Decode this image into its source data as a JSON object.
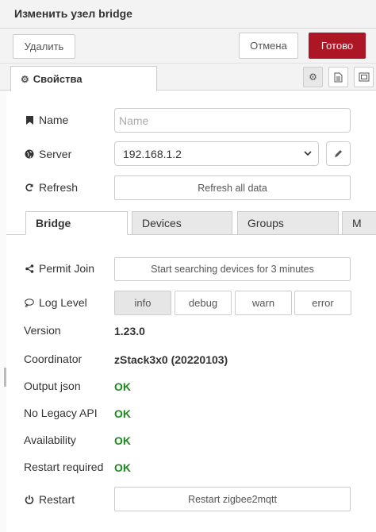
{
  "dialog": {
    "title": "Изменить узел bridge",
    "delete_label": "Удалить",
    "cancel_label": "Отмена",
    "done_label": "Готово",
    "accent_color": "#ad1625"
  },
  "tabs": {
    "properties_label": "Свойства",
    "icons": [
      "gear-icon",
      "document-icon",
      "frame-icon"
    ]
  },
  "form": {
    "name": {
      "label": "Name",
      "placeholder": "Name",
      "value": ""
    },
    "server": {
      "label": "Server",
      "value": "192.168.1.2"
    },
    "refresh": {
      "label": "Refresh",
      "button": "Refresh all data"
    }
  },
  "subtabs": [
    "Bridge",
    "Devices",
    "Groups",
    "M"
  ],
  "bridge": {
    "permit_join": {
      "label": "Permit Join",
      "button": "Start searching devices for 3 minutes"
    },
    "log_level": {
      "label": "Log Level",
      "options": [
        "info",
        "debug",
        "warn",
        "error"
      ],
      "selected": "info"
    },
    "version": {
      "label": "Version",
      "value": "1.23.0"
    },
    "coordinator": {
      "label": "Coordinator",
      "value": "zStack3x0 (20220103)"
    },
    "output_json": {
      "label": "Output json",
      "value": "OK"
    },
    "no_legacy_api": {
      "label": "No Legacy API",
      "value": "OK"
    },
    "availability": {
      "label": "Availability",
      "value": "OK"
    },
    "restart_required": {
      "label": "Restart required",
      "value": "OK"
    },
    "restart": {
      "label": "Restart",
      "button": "Restart zigbee2mqtt"
    }
  }
}
